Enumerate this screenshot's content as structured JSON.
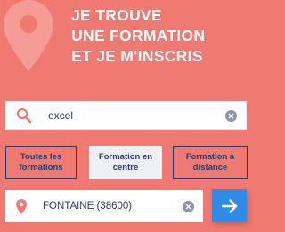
{
  "header": {
    "lines": [
      "JE TROUVE",
      "UNE FORMATION",
      "ET JE M'INSCRIS"
    ],
    "decoration_icon": "location-pin-icon"
  },
  "search": {
    "value": "excel",
    "icon": "search-icon"
  },
  "filters": [
    {
      "label": "Toutes les formations",
      "active": false
    },
    {
      "label": "Formation en centre",
      "active": true
    },
    {
      "label": "Formation à distance",
      "active": false
    }
  ],
  "location": {
    "value": "FONTAINE (38600)",
    "icon": "location-pin-icon"
  },
  "submit": {
    "icon": "arrow-right-icon"
  },
  "colors": {
    "background": "#f07a72",
    "accent": "#2e8be8",
    "text": "#2b3a67"
  }
}
